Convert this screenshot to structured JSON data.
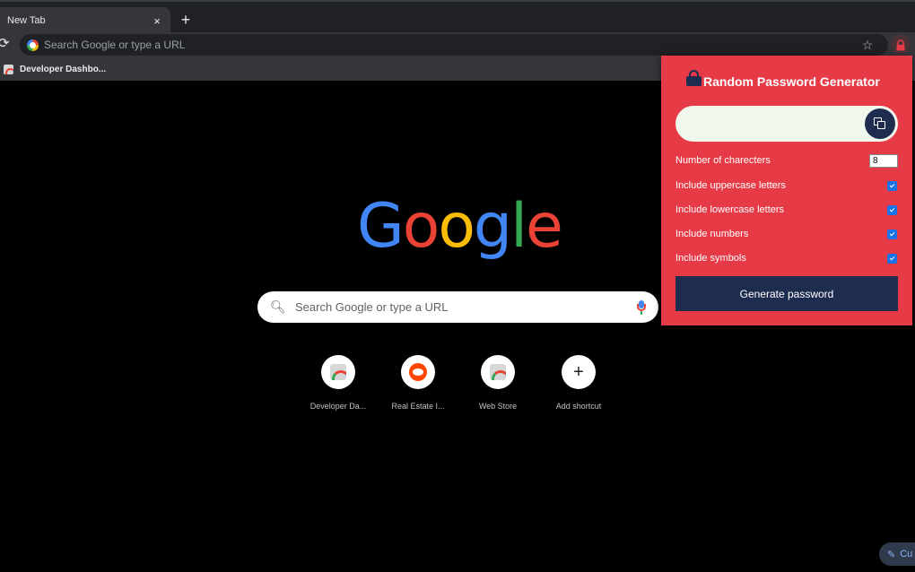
{
  "browser": {
    "tab": {
      "title": "New Tab",
      "close_glyph": "×"
    },
    "new_tab_glyph": "+",
    "omnibox": {
      "placeholder": "Search Google or type a URL"
    },
    "bookmarks": [
      {
        "label": "Developer Dashbo...",
        "icon": "chrome-web-store-icon"
      }
    ]
  },
  "ntp": {
    "logo_letters": [
      {
        "ch": "G",
        "color": "#4285f4"
      },
      {
        "ch": "o",
        "color": "#ea4335"
      },
      {
        "ch": "o",
        "color": "#fbbc05"
      },
      {
        "ch": "g",
        "color": "#4285f4"
      },
      {
        "ch": "l",
        "color": "#34a853"
      },
      {
        "ch": "e",
        "color": "#ea4335"
      }
    ],
    "search_placeholder": "Search Google or type a URL",
    "shortcuts": [
      {
        "label": "Developer Da...",
        "icon": "chrome-web-store-icon"
      },
      {
        "label": "Real Estate I...",
        "icon": "reddit-icon"
      },
      {
        "label": "Web Store",
        "icon": "chrome-web-store-icon"
      },
      {
        "label": "Add shortcut",
        "icon": "plus-icon"
      }
    ],
    "customize_label": "Cu"
  },
  "popup": {
    "title": "Random Password Generator",
    "password_value": "",
    "options": {
      "num_chars_label": "Number of charecters",
      "num_chars_value": "8",
      "uppercase_label": "Include uppercase letters",
      "lowercase_label": "Include lowercase letters",
      "numbers_label": "Include numbers",
      "symbols_label": "Include symbols",
      "uppercase_checked": true,
      "lowercase_checked": true,
      "numbers_checked": true,
      "symbols_checked": true
    },
    "generate_label": "Generate password"
  },
  "colors": {
    "popup_bg": "#e63b47",
    "popup_accent": "#1e2d4f",
    "checkbox": "#1a73e8"
  }
}
